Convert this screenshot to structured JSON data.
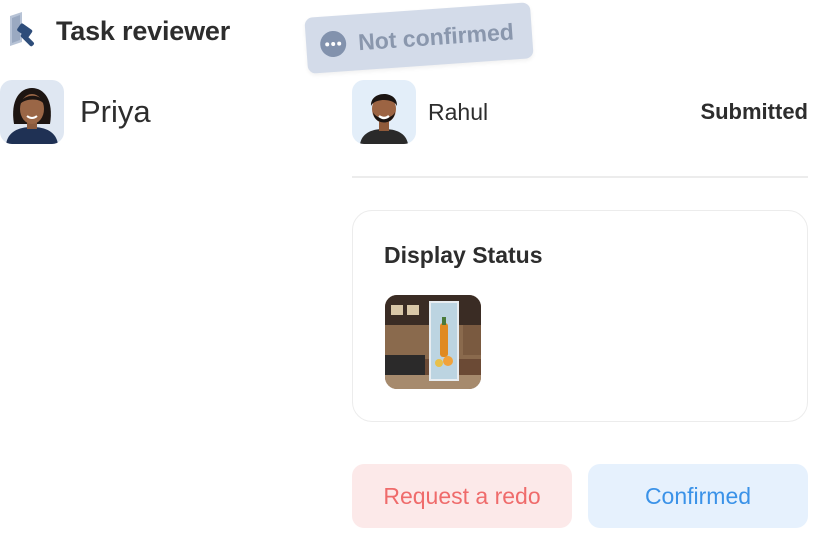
{
  "header": {
    "title": "Task reviewer",
    "icon": "hammer-doc-icon"
  },
  "status_chip": {
    "label": "Not confirmed",
    "icon": "ellipsis-icon",
    "bg": "#d3dbe9",
    "fg": "#8a97ad"
  },
  "self_user": {
    "name": "Priya",
    "avatar": "avatar-woman"
  },
  "assignee": {
    "name": "Rahul",
    "status": "Submitted",
    "avatar": "avatar-man"
  },
  "card": {
    "title": "Display Status",
    "thumbnail": "store-display-photo"
  },
  "actions": {
    "redo_label": "Request a redo",
    "confirm_label": "Confirmed",
    "redo_color": "#ef6b6b",
    "confirm_color": "#3a92e8"
  }
}
